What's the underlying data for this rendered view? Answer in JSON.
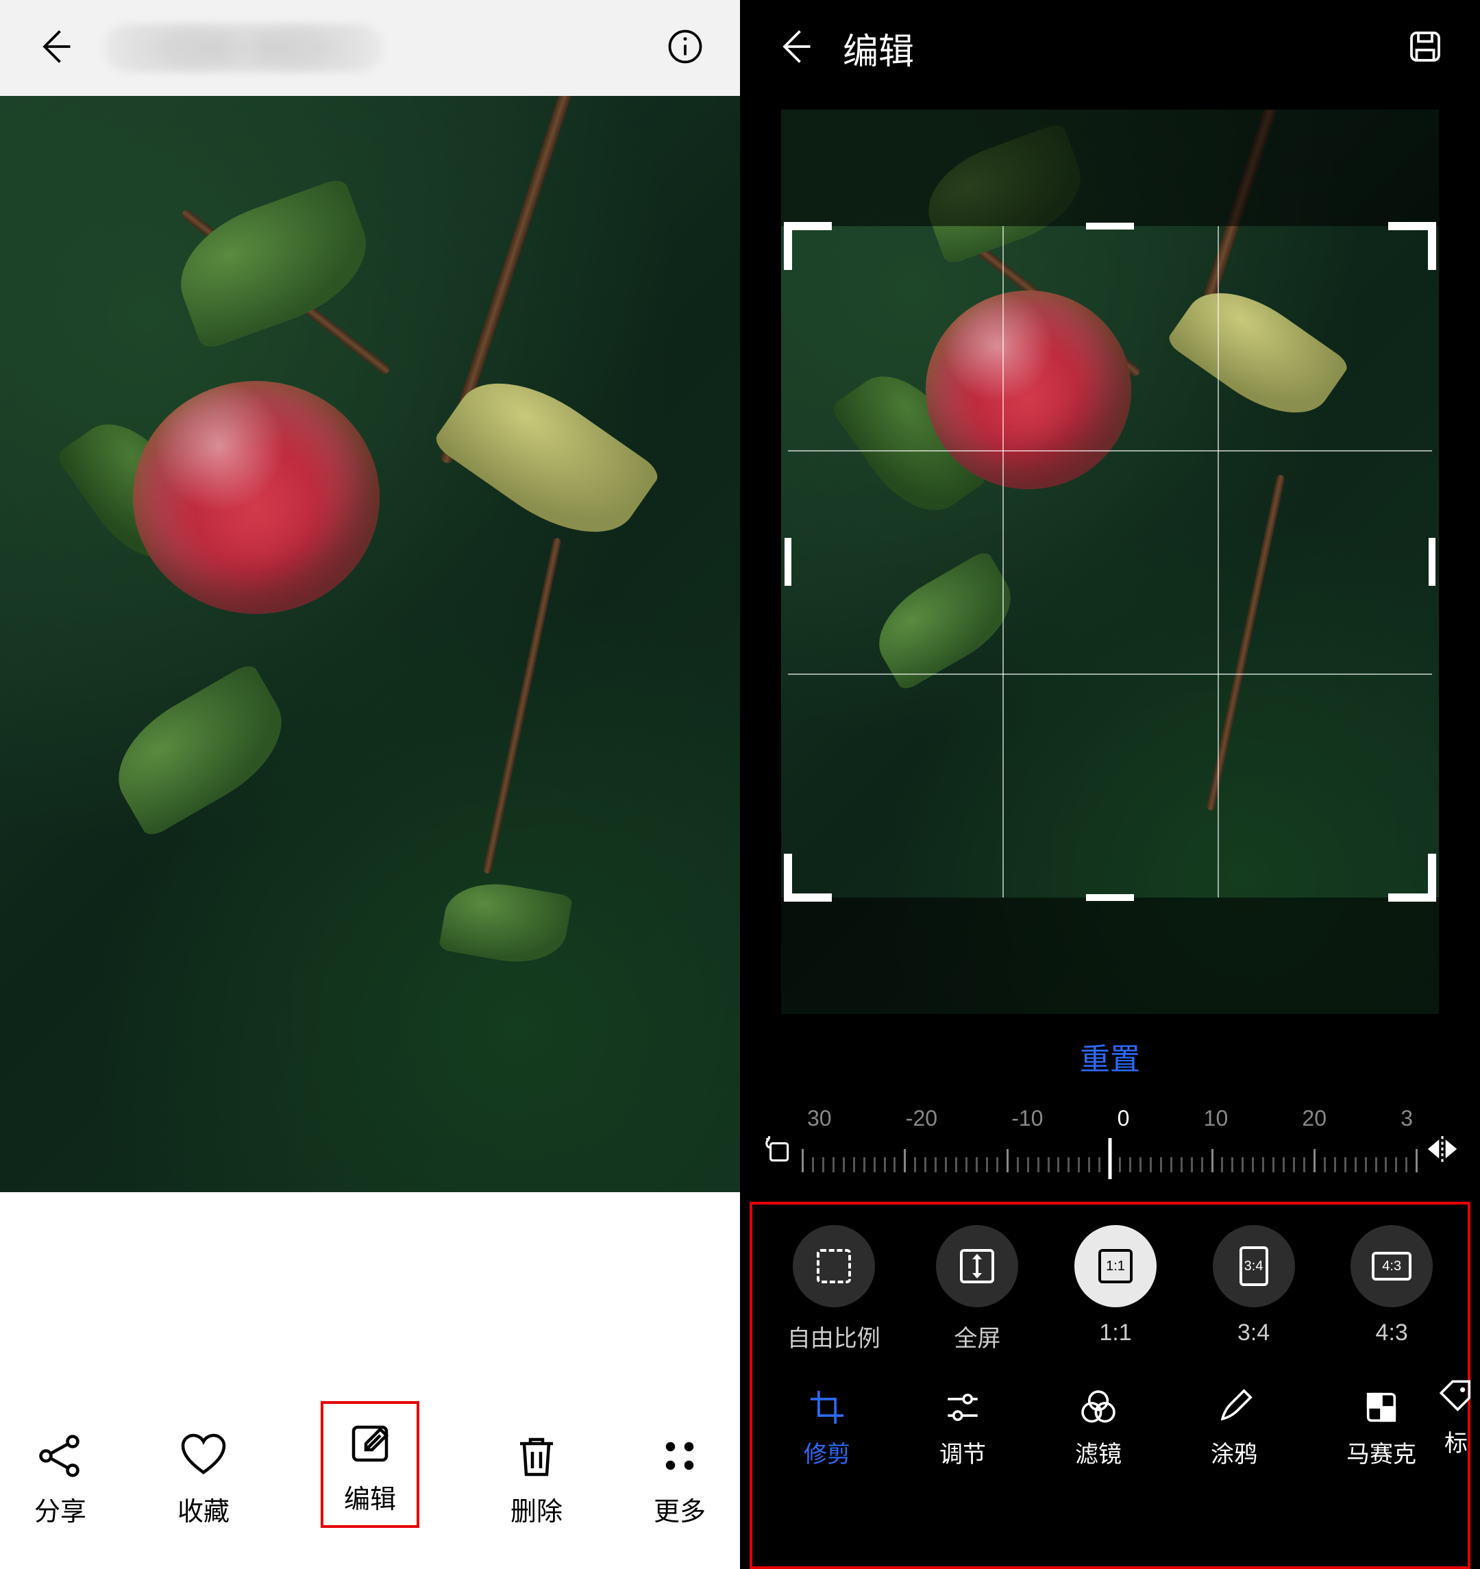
{
  "left": {
    "actions": {
      "share": "分享",
      "favorite": "收藏",
      "edit": "编辑",
      "delete": "删除",
      "more": "更多"
    }
  },
  "right": {
    "title": "编辑",
    "reset": "重置",
    "angle_ticks": [
      "30",
      "-20",
      "-10",
      "0",
      "10",
      "20",
      "3"
    ],
    "angle_active_index": 3,
    "ratios": [
      {
        "key": "free",
        "label": "自由比例"
      },
      {
        "key": "full",
        "label": "全屏"
      },
      {
        "key": "1_1",
        "label": "1:1",
        "text": "1:1",
        "active": true
      },
      {
        "key": "3_4",
        "label": "3:4",
        "text": "3:4"
      },
      {
        "key": "4_3",
        "label": "4:3",
        "text": "4:3"
      }
    ],
    "tools": {
      "crop": "修剪",
      "adjust": "调节",
      "filter": "滤镜",
      "doodle": "涂鸦",
      "mosaic": "马赛克",
      "label": "标"
    }
  }
}
